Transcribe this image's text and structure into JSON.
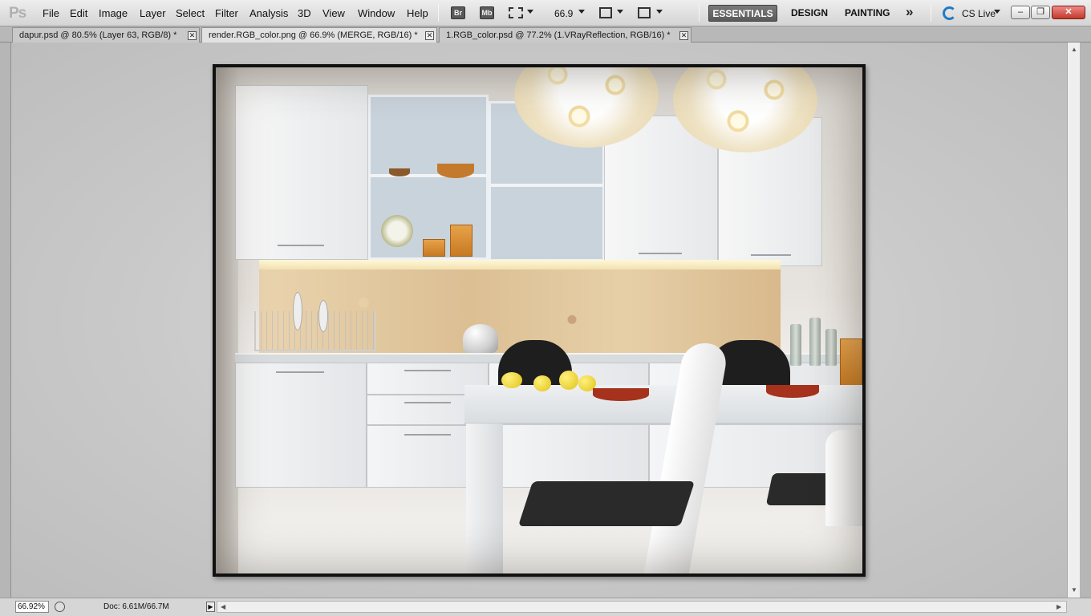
{
  "app": {
    "logo": "Ps"
  },
  "menu": {
    "items": [
      {
        "id": "file",
        "label": "File"
      },
      {
        "id": "edit",
        "label": "Edit"
      },
      {
        "id": "image",
        "label": "Image"
      },
      {
        "id": "layer",
        "label": "Layer"
      },
      {
        "id": "select",
        "label": "Select"
      },
      {
        "id": "filter",
        "label": "Filter"
      },
      {
        "id": "analysis",
        "label": "Analysis"
      },
      {
        "id": "3d",
        "label": "3D"
      },
      {
        "id": "view",
        "label": "View"
      },
      {
        "id": "window",
        "label": "Window"
      },
      {
        "id": "help",
        "label": "Help"
      }
    ]
  },
  "toolbar": {
    "bridge_label": "Br",
    "minibridge_label": "Mb",
    "zoom_value": "66.9",
    "icons": [
      "bridge-icon",
      "mini-bridge-icon",
      "film-strip-icon",
      "arrange-documents-icon",
      "screen-mode-icon"
    ]
  },
  "workspace": {
    "essentials": "ESSENTIALS",
    "design": "DESIGN",
    "painting": "PAINTING",
    "more": "»",
    "cs_live": "CS Live"
  },
  "window_controls": {
    "minimize": "–",
    "restore": "❐",
    "close": "✕"
  },
  "tabs": [
    {
      "label": "dapur.psd @ 80.5% (Layer 63, RGB/8) *",
      "active": false
    },
    {
      "label": "render.RGB_color.png @ 66.9% (MERGE, RGB/16) *",
      "active": true
    },
    {
      "label": "1.RGB_color.psd @ 77.2% (1.VRayReflection, RGB/16) *",
      "active": false
    }
  ],
  "status": {
    "zoom": "66.92%",
    "doc_info": "Doc: 6.61M/66.7M"
  },
  "colors": {
    "accent_blue": "#1f7bc6",
    "close_red": "#c23a2b",
    "canvas_bg": "#c9c9c9"
  }
}
